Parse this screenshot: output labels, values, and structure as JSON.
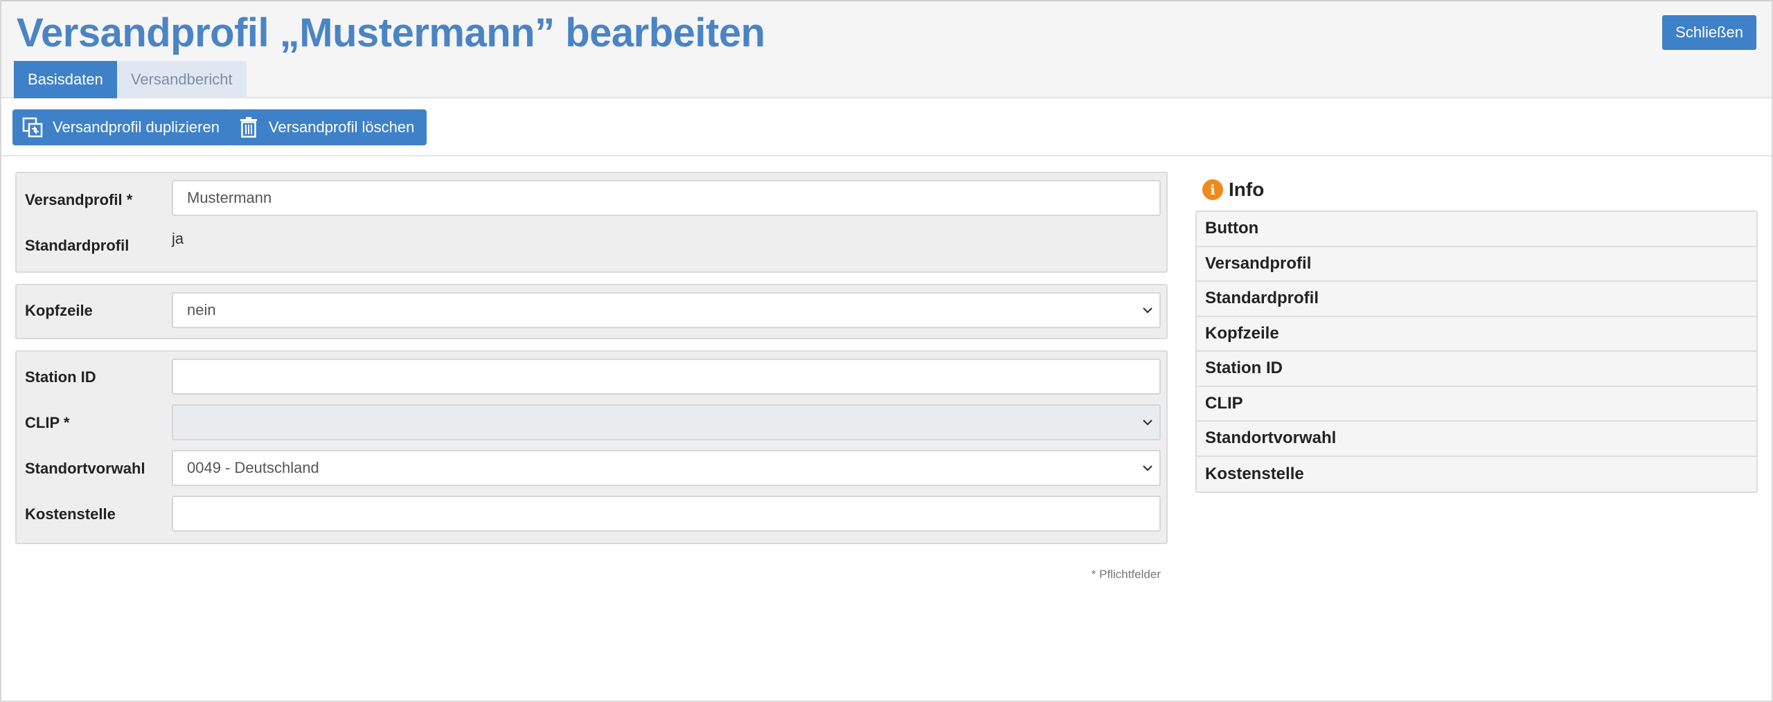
{
  "header": {
    "title": "Versandprofil „Mustermann” bearbeiten",
    "close_label": "Schließen"
  },
  "tabs": [
    {
      "label": "Basisdaten",
      "active": true
    },
    {
      "label": "Versandbericht",
      "active": false
    }
  ],
  "toolbar": {
    "duplicate_label": "Versandprofil duplizieren",
    "duplicate_icon": "duplicate-icon",
    "delete_label": "Versandprofil löschen",
    "delete_icon": "trash-icon"
  },
  "form": {
    "versandprofil": {
      "label": "Versandprofil *",
      "value": "Mustermann"
    },
    "standardprofil": {
      "label": "Standardprofil",
      "value": "ja"
    },
    "kopfzeile": {
      "label": "Kopfzeile",
      "value": "nein"
    },
    "station_id": {
      "label": "Station ID",
      "value": ""
    },
    "clip": {
      "label": "CLIP *",
      "value": ""
    },
    "standortvorwahl": {
      "label": "Standortvorwahl",
      "value": "0049 - Deutschland"
    },
    "kostenstelle": {
      "label": "Kostenstelle",
      "value": ""
    },
    "required_note": "* Pflichtfelder"
  },
  "info": {
    "title": "Info",
    "icon": "info-icon",
    "items": [
      "Button",
      "Versandprofil",
      "Standardprofil",
      "Kopfzeile",
      "Station ID",
      "CLIP",
      "Standortvorwahl",
      "Kostenstelle"
    ]
  },
  "colors": {
    "primary": "#3f81c8",
    "title": "#4a84c4",
    "info_accent": "#f08a1c"
  }
}
